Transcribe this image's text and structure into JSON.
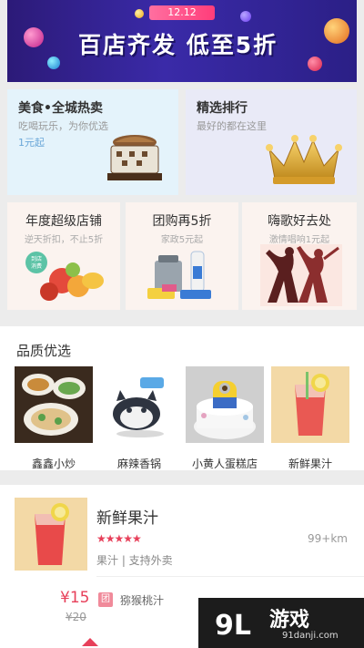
{
  "banner": {
    "tag": "12.12",
    "title": "百店齐发 低至5折"
  },
  "features": [
    {
      "title": "美食•全城热卖",
      "subtitle": "吃喝玩乐，为你优选",
      "price": "1元起"
    },
    {
      "title": "精选排行",
      "subtitle": "最好的都在这里"
    }
  ],
  "promos": [
    {
      "title": "年度超级店铺",
      "subtitle": "逆天折扣，不止5折",
      "badge": "到店消费"
    },
    {
      "title": "团购再5折",
      "subtitle": "家政5元起"
    },
    {
      "title": "嗨歌好去处",
      "subtitle": "激情唱响1元起"
    }
  ],
  "quality": {
    "title": "品质优选",
    "items": [
      {
        "name": "鑫鑫小炒"
      },
      {
        "name": "麻辣香锅"
      },
      {
        "name": "小黄人蛋糕店"
      },
      {
        "name": "新鲜果汁"
      }
    ]
  },
  "shop": {
    "name": "新鲜果汁",
    "stars": "★★★★★",
    "distance": "99+km",
    "tags": "果汁 | 支持外卖",
    "price": "¥15",
    "original_price": "¥20",
    "deal_badge": "团",
    "deal_name": "猕猴桃汁"
  },
  "watermark": {
    "brand": "游戏",
    "logo_text": "9L",
    "site": "91danji.com"
  },
  "colors": {
    "accent": "#e7405a"
  }
}
